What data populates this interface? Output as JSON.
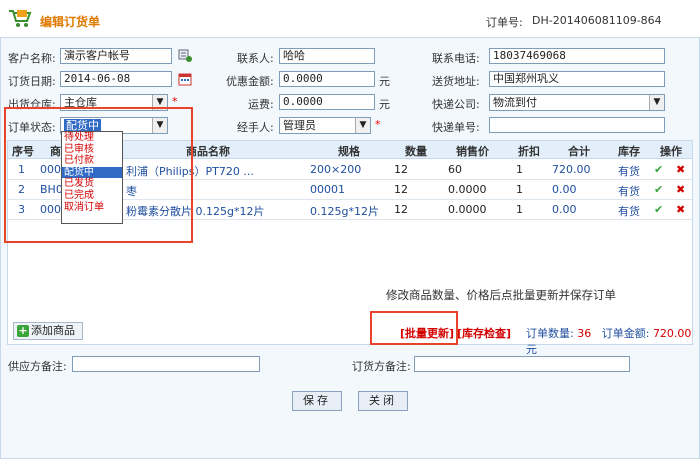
{
  "header": {
    "title": "编辑订货单",
    "order_label": "订单号:",
    "order_no": "DH-201406081109-864"
  },
  "form": {
    "customer_label": "客户名称:",
    "customer_value": "演示客户帐号",
    "contact_label": "联系人:",
    "contact_value": "哈哈",
    "phone_label": "联系电话:",
    "phone_value": "18037469068",
    "date_label": "订货日期:",
    "date_value": "2014-06-08",
    "discount_label": "优惠金额:",
    "discount_value": "0.0000",
    "discount_unit": "元",
    "address_label": "送货地址:",
    "address_value": "中国郑州巩义",
    "warehouse_label": "出货仓库:",
    "warehouse_value": "主仓库",
    "freight_label": "运费:",
    "freight_value": "0.0000",
    "freight_unit": "元",
    "courier_label": "快递公司:",
    "courier_value": "物流到付",
    "status_label": "订单状态:",
    "status_value": "配货中",
    "handler_label": "经手人:",
    "handler_value": "管理员",
    "tracking_label": "快递单号:",
    "tracking_value": "",
    "required_mark": "*"
  },
  "status_options": [
    "待处理",
    "已审核",
    "已付款",
    "配货中",
    "已发货",
    "已完成",
    "取消订单"
  ],
  "table": {
    "headers": [
      "序号",
      "商",
      "商品名称",
      "规格",
      "数量",
      "销售价",
      "折扣",
      "合计",
      "库存",
      "操作"
    ],
    "rows": [
      {
        "no": "1",
        "code": "000",
        "name": "利浦（Philips）PT720 ...",
        "spec": "200×200",
        "qty": "12",
        "price": "60",
        "discount": "1",
        "total": "720.00",
        "stock": "有货"
      },
      {
        "no": "2",
        "code": "BH0",
        "name": "枣",
        "spec": "00001",
        "qty": "12",
        "price": "0.0000",
        "discount": "1",
        "total": "0.00",
        "stock": "有货"
      },
      {
        "no": "3",
        "code": "000",
        "name": "粉霉素分散片 0.125g*12片",
        "spec": "0.125g*12片",
        "qty": "12",
        "price": "0.0000",
        "discount": "1",
        "total": "0.00",
        "stock": "有货"
      }
    ],
    "hint": "修改商品数量、价格后点批量更新并保存订单"
  },
  "footer_bar": {
    "add_label": "添加商品",
    "batch_label": "[批量更新]",
    "stock_label": "[库存检查]",
    "qty_label": "订单数量:",
    "qty_value": "36",
    "amount_label": "订单金额:",
    "amount_value": "720.00",
    "amount_unit": "元"
  },
  "remarks": {
    "supplier_label": "供应方备注:",
    "supplier_value": "",
    "buyer_label": "订货方备注:",
    "buyer_value": ""
  },
  "buttons": {
    "save": "保存",
    "close": "关闭"
  },
  "colors": {
    "accent": "#e07a00",
    "link": "#1f4fa0",
    "alert": "#d40000",
    "highlight": "#e8442a"
  }
}
